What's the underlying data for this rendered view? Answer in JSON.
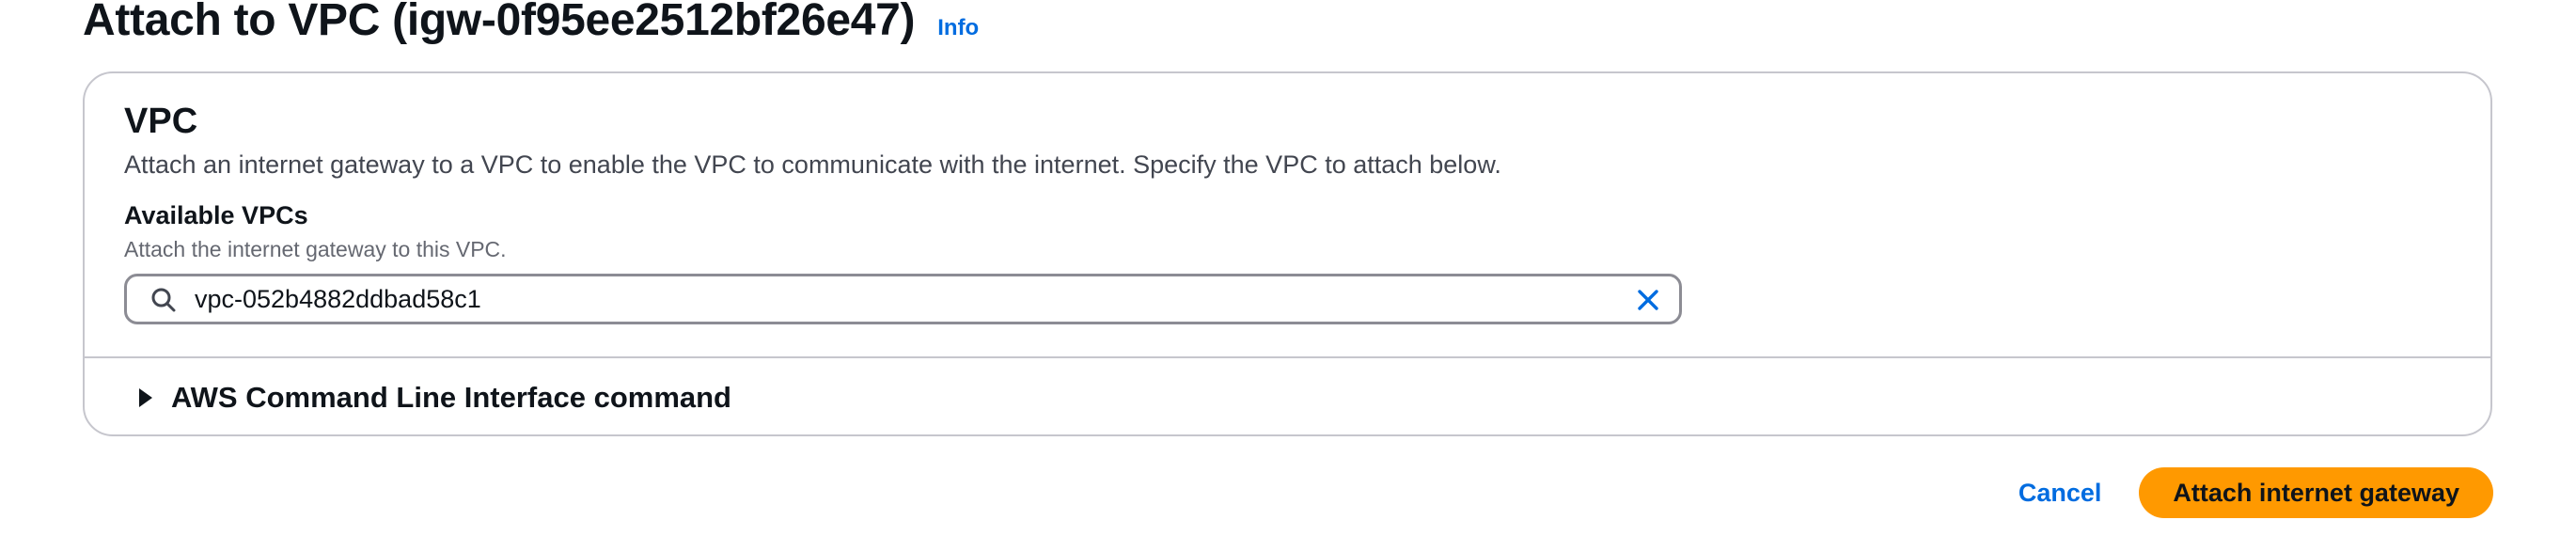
{
  "header": {
    "title": "Attach to VPC (igw-0f95ee2512bf26e47)",
    "info_link": "Info"
  },
  "section": {
    "title": "VPC",
    "description": "Attach an internet gateway to a VPC to enable the VPC to communicate with the internet. Specify the VPC to attach below."
  },
  "field": {
    "label": "Available VPCs",
    "description": "Attach the internet gateway to this VPC.",
    "value": "vpc-052b4882ddbad58c1",
    "search_icon": "search-icon",
    "clear_icon": "close-icon"
  },
  "expander": {
    "label": "AWS Command Line Interface command",
    "icon": "caret-right-icon",
    "expanded": false
  },
  "actions": {
    "cancel_label": "Cancel",
    "primary_label": "Attach internet gateway"
  },
  "colors": {
    "link": "#006ce0",
    "primary_button": "#ff9900",
    "border": "#c6c6cd",
    "input_border": "#8c8c94",
    "text": "#0f141a"
  }
}
